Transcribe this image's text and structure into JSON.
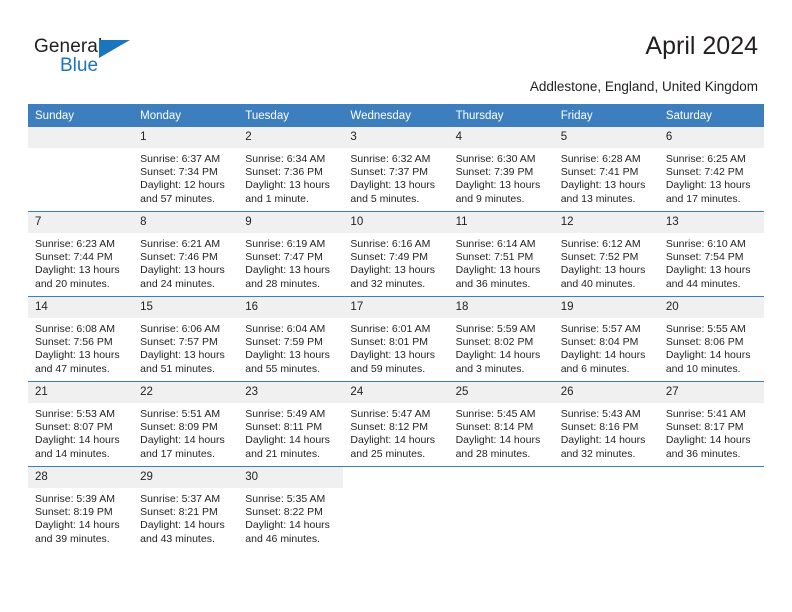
{
  "brand": {
    "name_top": "General",
    "name_bottom": "Blue"
  },
  "header": {
    "title": "April 2024",
    "subtitle": "Addlestone, England, United Kingdom"
  },
  "colors": {
    "header_blue": "#3d7ebe",
    "brand_blue": "#1b75bb",
    "daynum_band": "#f0f0f0",
    "text": "#231f20"
  },
  "weekday_headers": [
    "Sunday",
    "Monday",
    "Tuesday",
    "Wednesday",
    "Thursday",
    "Friday",
    "Saturday"
  ],
  "weeks": [
    [
      {
        "day": "",
        "sunrise": "",
        "sunset": "",
        "daylight1": "",
        "daylight2": "",
        "empty": true
      },
      {
        "day": "1",
        "sunrise": "Sunrise: 6:37 AM",
        "sunset": "Sunset: 7:34 PM",
        "daylight1": "Daylight: 12 hours",
        "daylight2": "and 57 minutes."
      },
      {
        "day": "2",
        "sunrise": "Sunrise: 6:34 AM",
        "sunset": "Sunset: 7:36 PM",
        "daylight1": "Daylight: 13 hours",
        "daylight2": "and 1 minute."
      },
      {
        "day": "3",
        "sunrise": "Sunrise: 6:32 AM",
        "sunset": "Sunset: 7:37 PM",
        "daylight1": "Daylight: 13 hours",
        "daylight2": "and 5 minutes."
      },
      {
        "day": "4",
        "sunrise": "Sunrise: 6:30 AM",
        "sunset": "Sunset: 7:39 PM",
        "daylight1": "Daylight: 13 hours",
        "daylight2": "and 9 minutes."
      },
      {
        "day": "5",
        "sunrise": "Sunrise: 6:28 AM",
        "sunset": "Sunset: 7:41 PM",
        "daylight1": "Daylight: 13 hours",
        "daylight2": "and 13 minutes."
      },
      {
        "day": "6",
        "sunrise": "Sunrise: 6:25 AM",
        "sunset": "Sunset: 7:42 PM",
        "daylight1": "Daylight: 13 hours",
        "daylight2": "and 17 minutes."
      }
    ],
    [
      {
        "day": "7",
        "sunrise": "Sunrise: 6:23 AM",
        "sunset": "Sunset: 7:44 PM",
        "daylight1": "Daylight: 13 hours",
        "daylight2": "and 20 minutes."
      },
      {
        "day": "8",
        "sunrise": "Sunrise: 6:21 AM",
        "sunset": "Sunset: 7:46 PM",
        "daylight1": "Daylight: 13 hours",
        "daylight2": "and 24 minutes."
      },
      {
        "day": "9",
        "sunrise": "Sunrise: 6:19 AM",
        "sunset": "Sunset: 7:47 PM",
        "daylight1": "Daylight: 13 hours",
        "daylight2": "and 28 minutes."
      },
      {
        "day": "10",
        "sunrise": "Sunrise: 6:16 AM",
        "sunset": "Sunset: 7:49 PM",
        "daylight1": "Daylight: 13 hours",
        "daylight2": "and 32 minutes."
      },
      {
        "day": "11",
        "sunrise": "Sunrise: 6:14 AM",
        "sunset": "Sunset: 7:51 PM",
        "daylight1": "Daylight: 13 hours",
        "daylight2": "and 36 minutes."
      },
      {
        "day": "12",
        "sunrise": "Sunrise: 6:12 AM",
        "sunset": "Sunset: 7:52 PM",
        "daylight1": "Daylight: 13 hours",
        "daylight2": "and 40 minutes."
      },
      {
        "day": "13",
        "sunrise": "Sunrise: 6:10 AM",
        "sunset": "Sunset: 7:54 PM",
        "daylight1": "Daylight: 13 hours",
        "daylight2": "and 44 minutes."
      }
    ],
    [
      {
        "day": "14",
        "sunrise": "Sunrise: 6:08 AM",
        "sunset": "Sunset: 7:56 PM",
        "daylight1": "Daylight: 13 hours",
        "daylight2": "and 47 minutes."
      },
      {
        "day": "15",
        "sunrise": "Sunrise: 6:06 AM",
        "sunset": "Sunset: 7:57 PM",
        "daylight1": "Daylight: 13 hours",
        "daylight2": "and 51 minutes."
      },
      {
        "day": "16",
        "sunrise": "Sunrise: 6:04 AM",
        "sunset": "Sunset: 7:59 PM",
        "daylight1": "Daylight: 13 hours",
        "daylight2": "and 55 minutes."
      },
      {
        "day": "17",
        "sunrise": "Sunrise: 6:01 AM",
        "sunset": "Sunset: 8:01 PM",
        "daylight1": "Daylight: 13 hours",
        "daylight2": "and 59 minutes."
      },
      {
        "day": "18",
        "sunrise": "Sunrise: 5:59 AM",
        "sunset": "Sunset: 8:02 PM",
        "daylight1": "Daylight: 14 hours",
        "daylight2": "and 3 minutes."
      },
      {
        "day": "19",
        "sunrise": "Sunrise: 5:57 AM",
        "sunset": "Sunset: 8:04 PM",
        "daylight1": "Daylight: 14 hours",
        "daylight2": "and 6 minutes."
      },
      {
        "day": "20",
        "sunrise": "Sunrise: 5:55 AM",
        "sunset": "Sunset: 8:06 PM",
        "daylight1": "Daylight: 14 hours",
        "daylight2": "and 10 minutes."
      }
    ],
    [
      {
        "day": "21",
        "sunrise": "Sunrise: 5:53 AM",
        "sunset": "Sunset: 8:07 PM",
        "daylight1": "Daylight: 14 hours",
        "daylight2": "and 14 minutes."
      },
      {
        "day": "22",
        "sunrise": "Sunrise: 5:51 AM",
        "sunset": "Sunset: 8:09 PM",
        "daylight1": "Daylight: 14 hours",
        "daylight2": "and 17 minutes."
      },
      {
        "day": "23",
        "sunrise": "Sunrise: 5:49 AM",
        "sunset": "Sunset: 8:11 PM",
        "daylight1": "Daylight: 14 hours",
        "daylight2": "and 21 minutes."
      },
      {
        "day": "24",
        "sunrise": "Sunrise: 5:47 AM",
        "sunset": "Sunset: 8:12 PM",
        "daylight1": "Daylight: 14 hours",
        "daylight2": "and 25 minutes."
      },
      {
        "day": "25",
        "sunrise": "Sunrise: 5:45 AM",
        "sunset": "Sunset: 8:14 PM",
        "daylight1": "Daylight: 14 hours",
        "daylight2": "and 28 minutes."
      },
      {
        "day": "26",
        "sunrise": "Sunrise: 5:43 AM",
        "sunset": "Sunset: 8:16 PM",
        "daylight1": "Daylight: 14 hours",
        "daylight2": "and 32 minutes."
      },
      {
        "day": "27",
        "sunrise": "Sunrise: 5:41 AM",
        "sunset": "Sunset: 8:17 PM",
        "daylight1": "Daylight: 14 hours",
        "daylight2": "and 36 minutes."
      }
    ],
    [
      {
        "day": "28",
        "sunrise": "Sunrise: 5:39 AM",
        "sunset": "Sunset: 8:19 PM",
        "daylight1": "Daylight: 14 hours",
        "daylight2": "and 39 minutes."
      },
      {
        "day": "29",
        "sunrise": "Sunrise: 5:37 AM",
        "sunset": "Sunset: 8:21 PM",
        "daylight1": "Daylight: 14 hours",
        "daylight2": "and 43 minutes."
      },
      {
        "day": "30",
        "sunrise": "Sunrise: 5:35 AM",
        "sunset": "Sunset: 8:22 PM",
        "daylight1": "Daylight: 14 hours",
        "daylight2": "and 46 minutes."
      },
      {
        "day": "",
        "sunrise": "",
        "sunset": "",
        "daylight1": "",
        "daylight2": "",
        "blank": true
      },
      {
        "day": "",
        "sunrise": "",
        "sunset": "",
        "daylight1": "",
        "daylight2": "",
        "blank": true
      },
      {
        "day": "",
        "sunrise": "",
        "sunset": "",
        "daylight1": "",
        "daylight2": "",
        "blank": true
      },
      {
        "day": "",
        "sunrise": "",
        "sunset": "",
        "daylight1": "",
        "daylight2": "",
        "blank": true
      }
    ]
  ]
}
